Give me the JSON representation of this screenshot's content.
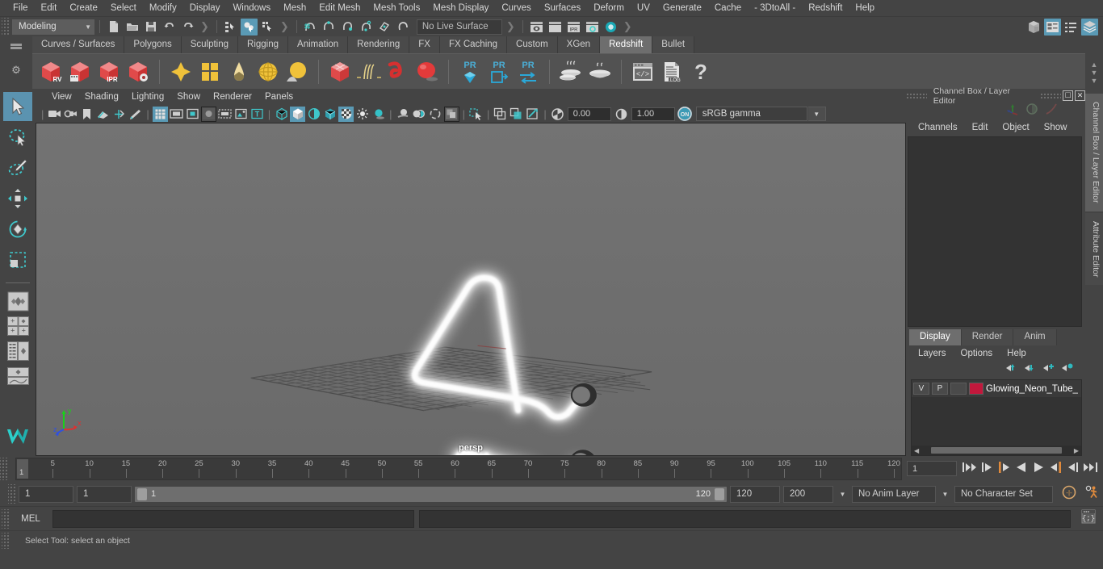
{
  "menubar": {
    "items": [
      "File",
      "Edit",
      "Create",
      "Select",
      "Modify",
      "Display",
      "Windows",
      "Mesh",
      "Edit Mesh",
      "Mesh Tools",
      "Mesh Display",
      "Curves",
      "Surfaces",
      "Deform",
      "UV",
      "Generate",
      "Cache",
      "- 3DtoAll -",
      "Redshift",
      "Help"
    ]
  },
  "statusline": {
    "menu_set": "Modeling",
    "live_surface": "No Live Surface"
  },
  "shelf": {
    "tabs": [
      "Curves / Surfaces",
      "Polygons",
      "Sculpting",
      "Rigging",
      "Animation",
      "Rendering",
      "FX",
      "FX Caching",
      "Custom",
      "XGen",
      "Redshift",
      "Bullet"
    ],
    "active_tab": "Redshift",
    "buttons": [
      {
        "name": "redshift-render-view",
        "label": "RV"
      },
      {
        "name": "redshift-render-sequence",
        "label": ""
      },
      {
        "name": "redshift-ipr",
        "label": "IPR"
      },
      {
        "name": "redshift-render-settings",
        "label": ""
      },
      {
        "name": "redshift-material",
        "label": ""
      },
      {
        "name": "redshift-material-blender",
        "label": ""
      },
      {
        "name": "redshift-incandescent",
        "label": ""
      },
      {
        "name": "redshift-sprite",
        "label": ""
      },
      {
        "name": "redshift-sss",
        "label": ""
      },
      {
        "name": "redshift-proxy",
        "label": ""
      },
      {
        "name": "redshift-hair",
        "label": ""
      },
      {
        "name": "redshift-volume",
        "label": ""
      },
      {
        "name": "redshift-object-props",
        "label": ""
      },
      {
        "name": "redshift-pr-light",
        "label": "PR"
      },
      {
        "name": "redshift-pr-export",
        "label": "PR"
      },
      {
        "name": "redshift-pr-transfer",
        "label": "PR"
      },
      {
        "name": "redshift-bake-set-hot",
        "label": ""
      },
      {
        "name": "redshift-bake-set",
        "label": ""
      },
      {
        "name": "redshift-script-editor",
        "label": ""
      },
      {
        "name": "redshift-log",
        "label": ".LOG"
      },
      {
        "name": "redshift-help",
        "label": "?"
      }
    ]
  },
  "viewport": {
    "menus": [
      "View",
      "Shading",
      "Lighting",
      "Show",
      "Renderer",
      "Panels"
    ],
    "exposure": "0.00",
    "gamma": "1.00",
    "color_management": "sRGB gamma",
    "camera_label": "persp",
    "axes": [
      "x",
      "y",
      "z"
    ]
  },
  "channel_box": {
    "title": "Channel Box / Layer Editor",
    "menus": [
      "Channels",
      "Edit",
      "Object",
      "Show"
    ]
  },
  "layer_editor": {
    "tabs": [
      "Display",
      "Render",
      "Anim"
    ],
    "active_tab": "Display",
    "menus": [
      "Layers",
      "Options",
      "Help"
    ],
    "layers": [
      {
        "visibility": "V",
        "playback": "P",
        "shade": "",
        "color": "#c2183c",
        "name": "Glowing_Neon_Tube_"
      }
    ]
  },
  "vertical_tabs": [
    "Channel Box / Layer Editor",
    "Attribute Editor"
  ],
  "timeline": {
    "ticks": [
      5,
      10,
      15,
      20,
      25,
      30,
      35,
      40,
      45,
      50,
      55,
      60,
      65,
      70,
      75,
      80,
      85,
      90,
      95,
      100,
      105,
      110,
      115,
      120
    ],
    "current_frame": "1",
    "current_frame_field": "1",
    "range_start": "1",
    "range_end": "1",
    "slider_start": "1",
    "slider_end": "120",
    "playback_end": "120",
    "scene_end": "200",
    "anim_layer": "No Anim Layer",
    "character_set": "No Character Set"
  },
  "command_line": {
    "label": "MEL",
    "value": "",
    "result": ""
  },
  "status_bar": {
    "message": "Select Tool: select an object"
  },
  "colors": {
    "accent_blue": "#5a9ab5",
    "shelf_red": "#e04a4a",
    "shelf_yellow": "#f0c23a",
    "layer_red": "#c2183c",
    "orange": "#e08a3c",
    "teal": "#2bb3b8"
  }
}
